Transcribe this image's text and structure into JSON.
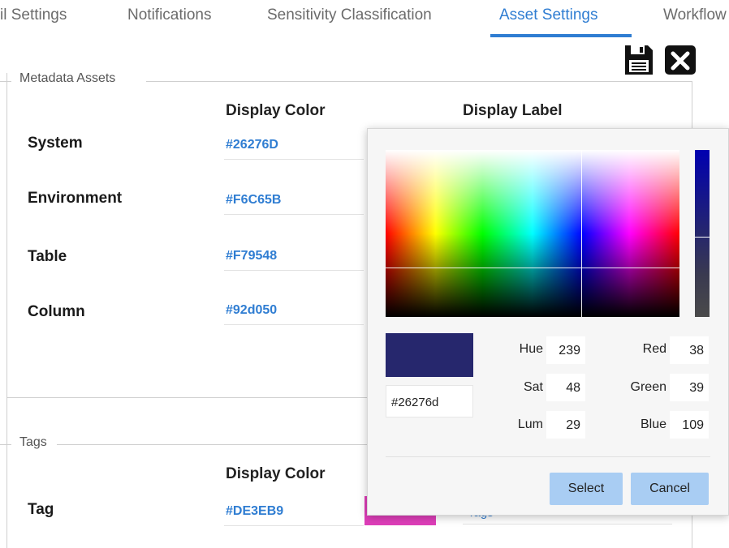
{
  "tabs": [
    {
      "label": "il Settings"
    },
    {
      "label": "Notifications"
    },
    {
      "label": "Sensitivity Classification"
    },
    {
      "label": "Asset Settings"
    },
    {
      "label": "Workflow"
    }
  ],
  "toolbar": {
    "save_icon": "save-icon",
    "close_icon": "close-icon"
  },
  "metadata": {
    "legend": "Metadata Assets",
    "col_color": "Display Color",
    "col_label": "Display Label",
    "rows": [
      {
        "label": "System",
        "color": "#26276D"
      },
      {
        "label": "Environment",
        "color": "#F6C65B"
      },
      {
        "label": "Table",
        "color": "#F79548"
      },
      {
        "label": "Column",
        "color": "#92d050"
      }
    ]
  },
  "tags": {
    "legend": "Tags",
    "col_color": "Display Color",
    "rows": [
      {
        "label": "Tag",
        "color": "#DE3EB9",
        "display_label": "Tags"
      }
    ]
  },
  "picker": {
    "hex": "#26276d",
    "hue_label": "Hue",
    "hue": "239",
    "sat_label": "Sat",
    "sat": "48",
    "lum_label": "Lum",
    "lum": "29",
    "red_label": "Red",
    "red": "38",
    "green_label": "Green",
    "green": "39",
    "blue_label": "Blue",
    "blue": "109",
    "select_label": "Select",
    "cancel_label": "Cancel"
  },
  "colors": {
    "accent": "#2f7dd2",
    "selected": "#26276d",
    "button": "#a9cdf3"
  }
}
